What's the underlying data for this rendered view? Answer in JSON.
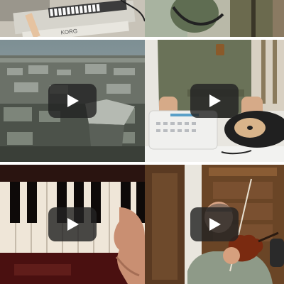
{
  "grid": {
    "tiles": [
      {
        "id": "top-left",
        "has_play": false
      },
      {
        "id": "top-right",
        "has_play": false
      },
      {
        "id": "middle-left",
        "has_play": true,
        "play_icon": "play-icon"
      },
      {
        "id": "middle-right",
        "has_play": true,
        "play_icon": "play-icon"
      },
      {
        "id": "bottom-left",
        "has_play": true,
        "play_icon": "play-icon"
      },
      {
        "id": "bottom-right",
        "has_play": true,
        "play_icon": "play-icon"
      }
    ],
    "colors": {
      "background": "#ffffff",
      "play_button_bg": "#232323",
      "play_triangle": "#ffffff"
    }
  },
  "thumbnails": {
    "top_left_brand": "KORG"
  }
}
